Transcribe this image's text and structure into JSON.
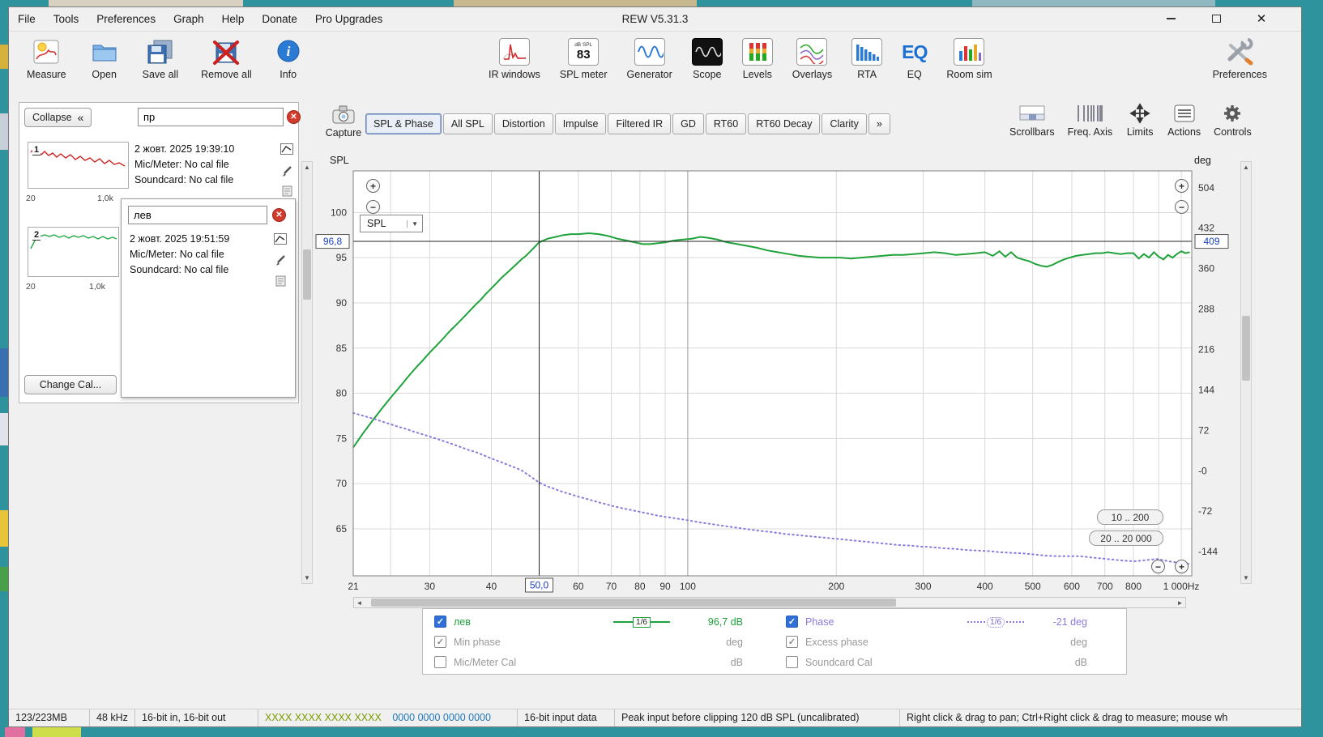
{
  "window": {
    "title": "REW V5.31.3",
    "menus": [
      "File",
      "Tools",
      "Preferences",
      "Graph",
      "Help",
      "Donate",
      "Pro Upgrades"
    ]
  },
  "icons": {
    "close": "✕",
    "remove": "✕",
    "dropdown": "▼",
    "zoom_in": "+",
    "zoom_out": "−",
    "arrow_left": "◄",
    "arrow_right": "►",
    "arrow_up": "▲",
    "arrow_down": "▼"
  },
  "toolbar": {
    "measure": "Measure",
    "open": "Open",
    "save_all": "Save all",
    "remove_all": "Remove all",
    "info": "Info",
    "ir_windows": "IR windows",
    "spl_meter": "SPL meter",
    "spl_caption": "dB SPL",
    "spl_value": "83",
    "generator": "Generator",
    "scope": "Scope",
    "levels": "Levels",
    "overlays": "Overlays",
    "rta": "RTA",
    "eq": "EQ",
    "room_sim": "Room sim",
    "preferences": "Preferences"
  },
  "sidebar": {
    "collapse": "Collapse",
    "collapse_arrows": "«",
    "change_cal": "Change Cal...",
    "m1": {
      "num": "1",
      "name": "пр",
      "date": "2 жовт. 2025 19:39:10",
      "mic": "Mic/Meter: No cal file",
      "sc": "Soundcard: No cal file",
      "fmin": "20",
      "fmax": "1,0k",
      "color": "#cc2222"
    },
    "m2": {
      "num": "2",
      "name": "лев",
      "date": "2 жовт. 2025 19:51:59",
      "mic": "Mic/Meter: No cal file",
      "sc": "Soundcard: No cal file",
      "fmin": "20",
      "fmax": "1,0k",
      "color": "#22aa44"
    }
  },
  "graph": {
    "capture": "Capture",
    "tabs": [
      "SPL & Phase",
      "All SPL",
      "Distortion",
      "Impulse",
      "Filtered IR",
      "GD",
      "RT60",
      "RT60 Decay",
      "Clarity",
      "»"
    ],
    "active_tab": "SPL & Phase",
    "tools": [
      "Scrollbars",
      "Freq. Axis",
      "Limits",
      "Actions",
      "Controls"
    ],
    "axis_left": "SPL",
    "axis_right": "deg",
    "series_select": "SPL",
    "range1": "10 .. 200",
    "range2": "20 .. 20 000"
  },
  "chart_data": {
    "type": "line",
    "title": "SPL & Phase",
    "grid": true,
    "grid_color": "#d9d9d9",
    "major_grid": [
      100
    ],
    "major_color": "#9a9a9a",
    "x_axis": {
      "scale": "log",
      "unit": "Hz",
      "min": 21,
      "max": 1050,
      "ticks": [
        {
          "f": 21,
          "label": "21"
        },
        {
          "f": 25,
          "label": ""
        },
        {
          "f": 30,
          "label": "30"
        },
        {
          "f": 40,
          "label": "40"
        },
        {
          "f": 50,
          "label": "50"
        },
        {
          "f": 60,
          "label": "60"
        },
        {
          "f": 70,
          "label": "70"
        },
        {
          "f": 80,
          "label": "80"
        },
        {
          "f": 90,
          "label": "90"
        },
        {
          "f": 100,
          "label": "100"
        },
        {
          "f": 200,
          "label": "200"
        },
        {
          "f": 300,
          "label": "300"
        },
        {
          "f": 400,
          "label": "400"
        },
        {
          "f": 500,
          "label": "500"
        },
        {
          "f": 600,
          "label": "600"
        },
        {
          "f": 700,
          "label": "700"
        },
        {
          "f": 800,
          "label": "800"
        },
        {
          "f": 900,
          "label": ""
        },
        {
          "f": 1000,
          "label": "1 000Hz"
        }
      ]
    },
    "y_left": {
      "title": "SPL",
      "unit": "dB",
      "min": 59.8,
      "max": 104.6,
      "ticks": [
        100,
        95,
        90,
        85,
        80,
        75,
        70,
        65
      ]
    },
    "y_right": {
      "title": "deg",
      "unit": "deg",
      "min": -187,
      "max": 534,
      "ticks": [
        {
          "v": 504,
          "label": "504"
        },
        {
          "v": 432,
          "label": "432"
        },
        {
          "v": 360,
          "label": "360"
        },
        {
          "v": 288,
          "label": "288"
        },
        {
          "v": 216,
          "label": "216"
        },
        {
          "v": 144,
          "label": "144"
        },
        {
          "v": 72,
          "label": "72"
        },
        {
          "v": 0,
          "label": "-0"
        },
        {
          "v": -72,
          "label": "-72"
        },
        {
          "v": -144,
          "label": "-144"
        }
      ]
    },
    "cursor": {
      "freq": 50,
      "freq_label": "50,0",
      "spl": 96.8,
      "spl_label": "96,8",
      "deg": 409,
      "deg_label": "409"
    },
    "series": [
      {
        "name": "лев",
        "axis": "left",
        "color": "#1fa23a",
        "style": "solid",
        "smoothing": "1/6",
        "cursor_value": "96,7 dB",
        "points": [
          [
            21,
            74
          ],
          [
            22,
            75.6
          ],
          [
            23,
            77
          ],
          [
            24,
            78.3
          ],
          [
            25,
            79.5
          ],
          [
            26,
            80.6
          ],
          [
            27,
            81.7
          ],
          [
            28,
            82.7
          ],
          [
            29,
            83.6
          ],
          [
            30,
            84.5
          ],
          [
            31,
            85.3
          ],
          [
            32,
            86.1
          ],
          [
            33,
            86.9
          ],
          [
            34,
            87.6
          ],
          [
            35,
            88.3
          ],
          [
            36,
            89
          ],
          [
            37,
            89.7
          ],
          [
            38,
            90.3
          ],
          [
            39,
            91
          ],
          [
            40,
            91.6
          ],
          [
            41,
            92.2
          ],
          [
            42,
            92.8
          ],
          [
            43,
            93.3
          ],
          [
            44,
            93.8
          ],
          [
            45,
            94.3
          ],
          [
            46,
            94.8
          ],
          [
            47,
            95.2
          ],
          [
            48,
            95.7
          ],
          [
            49,
            96.2
          ],
          [
            50,
            96.7
          ],
          [
            52,
            97.1
          ],
          [
            54,
            97.3
          ],
          [
            56,
            97.5
          ],
          [
            58,
            97.6
          ],
          [
            60,
            97.6
          ],
          [
            63,
            97.7
          ],
          [
            66,
            97.6
          ],
          [
            69,
            97.4
          ],
          [
            72,
            97.1
          ],
          [
            75,
            96.9
          ],
          [
            78,
            96.7
          ],
          [
            81,
            96.5
          ],
          [
            84,
            96.5
          ],
          [
            87,
            96.6
          ],
          [
            90,
            96.7
          ],
          [
            94,
            96.9
          ],
          [
            98,
            97
          ],
          [
            102,
            97.1
          ],
          [
            106,
            97.3
          ],
          [
            110,
            97.2
          ],
          [
            115,
            97
          ],
          [
            120,
            96.7
          ],
          [
            126,
            96.5
          ],
          [
            132,
            96.3
          ],
          [
            138,
            96.1
          ],
          [
            145,
            95.8
          ],
          [
            152,
            95.6
          ],
          [
            160,
            95.4
          ],
          [
            168,
            95.2
          ],
          [
            176,
            95.1
          ],
          [
            185,
            95
          ],
          [
            194,
            95
          ],
          [
            204,
            95
          ],
          [
            214,
            94.9
          ],
          [
            225,
            95
          ],
          [
            236,
            95.1
          ],
          [
            248,
            95.2
          ],
          [
            260,
            95.3
          ],
          [
            273,
            95.3
          ],
          [
            287,
            95.4
          ],
          [
            301,
            95.5
          ],
          [
            316,
            95.6
          ],
          [
            332,
            95.5
          ],
          [
            349,
            95.3
          ],
          [
            366,
            95.4
          ],
          [
            384,
            95.5
          ],
          [
            400,
            95.6
          ],
          [
            415,
            95.2
          ],
          [
            428,
            95.7
          ],
          [
            440,
            95.1
          ],
          [
            452,
            95.6
          ],
          [
            465,
            95
          ],
          [
            478,
            94.8
          ],
          [
            492,
            94.6
          ],
          [
            506,
            94.3
          ],
          [
            520,
            94.1
          ],
          [
            534,
            94
          ],
          [
            548,
            94.2
          ],
          [
            562,
            94.5
          ],
          [
            578,
            94.8
          ],
          [
            594,
            95
          ],
          [
            612,
            95.2
          ],
          [
            630,
            95.3
          ],
          [
            650,
            95.4
          ],
          [
            670,
            95.5
          ],
          [
            690,
            95.5
          ],
          [
            710,
            95.6
          ],
          [
            732,
            95.5
          ],
          [
            754,
            95.4
          ],
          [
            777,
            95.5
          ],
          [
            800,
            95.5
          ],
          [
            820,
            94.9
          ],
          [
            840,
            95.4
          ],
          [
            860,
            95
          ],
          [
            880,
            95.6
          ],
          [
            900,
            95.1
          ],
          [
            920,
            94.8
          ],
          [
            940,
            95.3
          ],
          [
            960,
            95
          ],
          [
            980,
            95.4
          ],
          [
            1000,
            95.7
          ],
          [
            1020,
            95.5
          ],
          [
            1040,
            95.6
          ]
        ]
      },
      {
        "name": "Phase",
        "axis": "right",
        "color": "#8a7ae0",
        "style": "dotted",
        "smoothing": "1/6",
        "cursor_value": "-21 deg",
        "points": [
          [
            21,
            103
          ],
          [
            22,
            98
          ],
          [
            23,
            93
          ],
          [
            24,
            88
          ],
          [
            25,
            83
          ],
          [
            26,
            78
          ],
          [
            27,
            74
          ],
          [
            28,
            69
          ],
          [
            29,
            65
          ],
          [
            30,
            61
          ],
          [
            31,
            57
          ],
          [
            32,
            53
          ],
          [
            33,
            49
          ],
          [
            34,
            45
          ],
          [
            35,
            41
          ],
          [
            36,
            37
          ],
          [
            37,
            34
          ],
          [
            38,
            30
          ],
          [
            39,
            26
          ],
          [
            40,
            22
          ],
          [
            42,
            15
          ],
          [
            44,
            8
          ],
          [
            46,
            1
          ],
          [
            48,
            -10
          ],
          [
            50,
            -21
          ],
          [
            52,
            -28
          ],
          [
            54,
            -33
          ],
          [
            56,
            -38
          ],
          [
            58,
            -42
          ],
          [
            60,
            -46
          ],
          [
            63,
            -51
          ],
          [
            66,
            -56
          ],
          [
            70,
            -62
          ],
          [
            74,
            -67
          ],
          [
            78,
            -71
          ],
          [
            82,
            -75
          ],
          [
            86,
            -79
          ],
          [
            90,
            -82
          ],
          [
            95,
            -85
          ],
          [
            100,
            -88
          ],
          [
            106,
            -92
          ],
          [
            112,
            -95
          ],
          [
            118,
            -98
          ],
          [
            125,
            -101
          ],
          [
            132,
            -104
          ],
          [
            140,
            -107
          ],
          [
            148,
            -109
          ],
          [
            156,
            -112
          ],
          [
            165,
            -114
          ],
          [
            174,
            -116
          ],
          [
            184,
            -118
          ],
          [
            194,
            -120
          ],
          [
            205,
            -122
          ],
          [
            216,
            -124
          ],
          [
            228,
            -126
          ],
          [
            240,
            -128
          ],
          [
            253,
            -130
          ],
          [
            267,
            -132
          ],
          [
            282,
            -133
          ],
          [
            297,
            -135
          ],
          [
            313,
            -136
          ],
          [
            330,
            -138
          ],
          [
            348,
            -139
          ],
          [
            367,
            -141
          ],
          [
            387,
            -142
          ],
          [
            408,
            -143
          ],
          [
            430,
            -145
          ],
          [
            453,
            -146
          ],
          [
            478,
            -147
          ],
          [
            503,
            -149
          ],
          [
            530,
            -151
          ],
          [
            558,
            -152
          ],
          [
            588,
            -152
          ],
          [
            620,
            -152
          ],
          [
            653,
            -154
          ],
          [
            688,
            -156
          ],
          [
            725,
            -158
          ],
          [
            764,
            -160
          ],
          [
            805,
            -161
          ],
          [
            848,
            -159
          ],
          [
            894,
            -157
          ],
          [
            942,
            -161
          ],
          [
            993,
            -164
          ],
          [
            1040,
            -166
          ]
        ]
      }
    ]
  },
  "legend": {
    "rows": [
      {
        "l_checked": true,
        "l_label": "лев",
        "l_color": "#1fa23a",
        "l_smooth": "1/6",
        "l_value": "96,7 dB",
        "r_checked": true,
        "r_label": "Phase",
        "r_color": "#8a7ae0",
        "r_smooth": "1/6",
        "r_value": "-21 deg"
      },
      {
        "l_checked": true,
        "l_label": "Min phase",
        "l_value": "deg",
        "r_checked": true,
        "r_label": "Excess phase",
        "r_value": "deg"
      },
      {
        "l_checked": false,
        "l_label": "Mic/Meter Cal",
        "l_value": "dB",
        "r_checked": false,
        "r_label": "Soundcard Cal",
        "r_value": "dB"
      }
    ]
  },
  "statusbar": {
    "memory": "123/223MB",
    "rate": "48 kHz",
    "bits": "16-bit in, 16-bit out",
    "bits_green": "XXXX XXXX  XXXX XXXX",
    "bits_blue": "0000 0000  0000 0000",
    "input": "16-bit input data",
    "peak": "Peak input before clipping 120 dB SPL (uncalibrated)",
    "hint": "Right click & drag to pan; Ctrl+Right click & drag to measure; mouse wh"
  }
}
